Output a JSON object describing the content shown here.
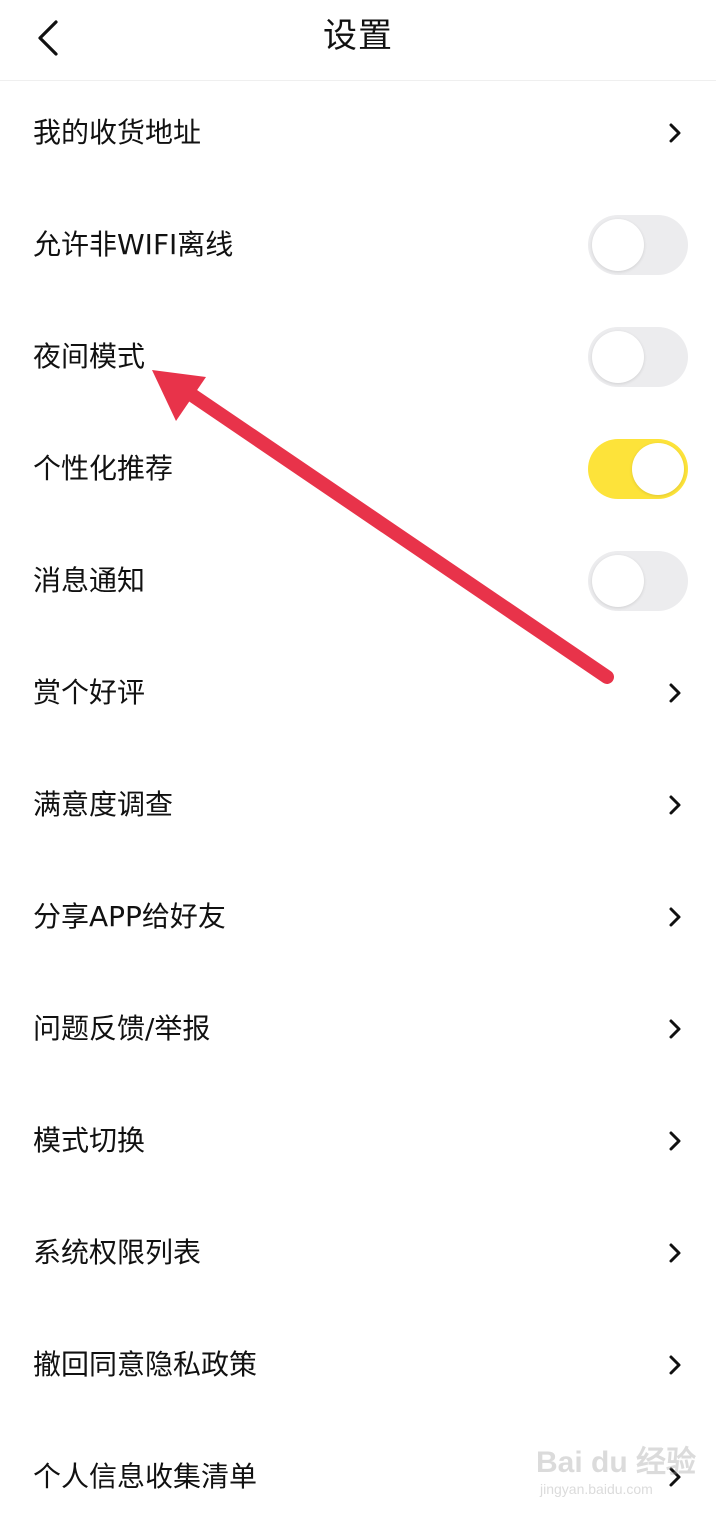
{
  "header": {
    "title": "设置",
    "back_icon": "chevron-left-icon"
  },
  "settings": [
    {
      "label": "我的收货地址",
      "control": "chevron"
    },
    {
      "label": "允许非WIFI离线",
      "control": "toggle",
      "on": false
    },
    {
      "label": "夜间模式",
      "control": "toggle",
      "on": false
    },
    {
      "label": "个性化推荐",
      "control": "toggle",
      "on": true
    },
    {
      "label": "消息通知",
      "control": "toggle",
      "on": false
    },
    {
      "label": "赏个好评",
      "control": "chevron"
    },
    {
      "label": "满意度调查",
      "control": "chevron"
    },
    {
      "label": "分享APP给好友",
      "control": "chevron"
    },
    {
      "label": "问题反馈/举报",
      "control": "chevron"
    },
    {
      "label": "模式切换",
      "control": "chevron"
    },
    {
      "label": "系统权限列表",
      "control": "chevron"
    },
    {
      "label": "撤回同意隐私政策",
      "control": "chevron"
    },
    {
      "label": "个人信息收集清单",
      "control": "chevron"
    }
  ],
  "colors": {
    "toggle_on": "#fde33a",
    "toggle_off": "#ececee",
    "annotation_arrow": "#e8334a"
  },
  "watermark": {
    "text": "Bai du 经验",
    "url_text": "jingyan.baidu.com"
  }
}
